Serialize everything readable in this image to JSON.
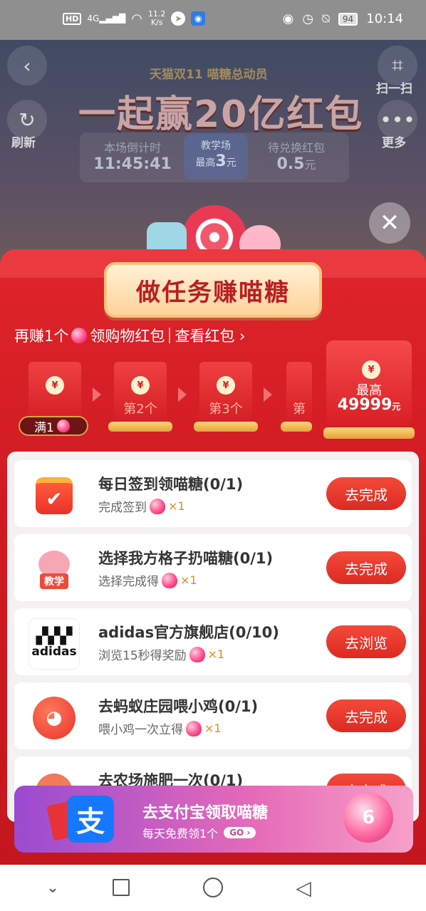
{
  "status_bar": {
    "hd": "HD",
    "network": "4G",
    "speed_value": "11.2",
    "speed_unit": "K/s",
    "battery": "94",
    "time": "10:14"
  },
  "background": {
    "back_icon": "back-icon",
    "refresh_label": "刷新",
    "scan_label": "扫一扫",
    "more_label": "更多",
    "event_subtitle": "天猫双11 喵糖总动员",
    "event_title": "一起赢20亿红包",
    "countdown_label": "本场倒计时",
    "countdown_value": "11:45:41",
    "teach_label": "教学场",
    "teach_max_prefix": "最高",
    "teach_max_value": "3",
    "teach_max_unit": "元",
    "pending_label": "待兑换红包",
    "pending_value": "0.5",
    "pending_unit": "元"
  },
  "modal": {
    "title": "做任务赚喵糖",
    "earn_prefix": "再赚1个",
    "earn_suffix": "领购物红包",
    "view_link": "查看红包",
    "envelopes": [
      {
        "label": "满1"
      },
      {
        "label": "第2个"
      },
      {
        "label": "第3个"
      },
      {
        "label": "第"
      }
    ],
    "grand_envelope": {
      "line1": "最高",
      "amount": "49999",
      "unit": "元"
    }
  },
  "tasks": [
    {
      "title": "每日签到领喵糖(0/1)",
      "subtitle": "完成签到",
      "reward": "×1",
      "button": "去完成",
      "icon": "calendar-check-icon"
    },
    {
      "title": "选择我方格子扔喵糖(0/1)",
      "subtitle": "选择完成得",
      "reward": "×1",
      "button": "去完成",
      "icon": "cat-teach-icon",
      "icon_badge": "教学"
    },
    {
      "title": "adidas官方旗舰店(0/10)",
      "subtitle": "浏览15秒得奖励",
      "reward": "×1",
      "button": "去浏览",
      "icon": "adidas-logo-icon",
      "icon_text": "adidas"
    },
    {
      "title": "去蚂蚁庄园喂小鸡(0/1)",
      "subtitle": "喂小鸡一次立得",
      "reward": "×1",
      "button": "去完成",
      "icon": "chick-icon"
    },
    {
      "title": "去农场施肥一次(0/1)",
      "subtitle": "",
      "reward": "",
      "button": "去完成",
      "icon": "farm-icon"
    }
  ],
  "promo": {
    "logo_text": "支",
    "title": "去支付宝领取喵糖",
    "subtitle": "每天免费领1个",
    "go": "GO",
    "orb_number": "6"
  },
  "colors": {
    "sheet_red": "#d41f24",
    "button_red": "#ec3b30",
    "promo_purple": "#9a4bd0",
    "promo_pink": "#e66ab8",
    "alipay_blue": "#1677ff"
  }
}
